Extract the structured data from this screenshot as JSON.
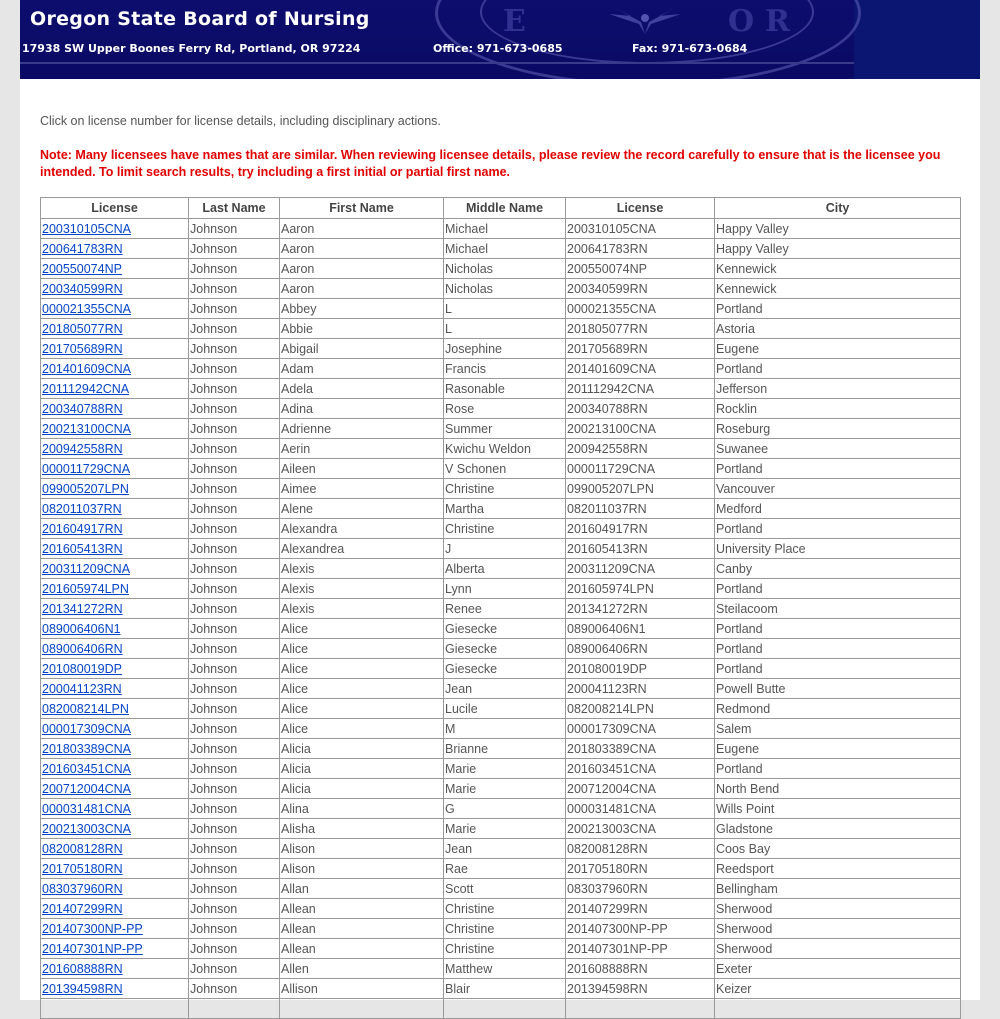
{
  "header": {
    "title": "Oregon State Board of Nursing",
    "address": "17938 SW Upper Boones Ferry Rd, Portland, OR 97224",
    "office": "Office: 971-673-0685",
    "fax": "Fax: 971-673-0684"
  },
  "intro": "Click on license number for license details, including disciplinary actions.",
  "note": "Note: Many licensees have names that are similar. When reviewing licensee details, please review the record carefully to ensure that is the licensee you intended. To limit search results, try including a first initial or partial first name.",
  "table": {
    "columns": [
      "License",
      "Last Name",
      "First Name",
      "Middle Name",
      "License",
      "City"
    ],
    "rows": [
      [
        "200310105CNA",
        "Johnson",
        "Aaron",
        "Michael",
        "200310105CNA",
        "Happy Valley"
      ],
      [
        "200641783RN",
        "Johnson",
        "Aaron",
        "Michael",
        "200641783RN",
        "Happy Valley"
      ],
      [
        "200550074NP",
        "Johnson",
        "Aaron",
        "Nicholas",
        "200550074NP",
        "Kennewick"
      ],
      [
        "200340599RN",
        "Johnson",
        "Aaron",
        "Nicholas",
        "200340599RN",
        "Kennewick"
      ],
      [
        "000021355CNA",
        "Johnson",
        "Abbey",
        "L",
        "000021355CNA",
        "Portland"
      ],
      [
        "201805077RN",
        "Johnson",
        "Abbie",
        "L",
        "201805077RN",
        "Astoria"
      ],
      [
        "201705689RN",
        "Johnson",
        "Abigail",
        "Josephine",
        "201705689RN",
        "Eugene"
      ],
      [
        "201401609CNA",
        "Johnson",
        "Adam",
        "Francis",
        "201401609CNA",
        "Portland"
      ],
      [
        "201112942CNA",
        "Johnson",
        "Adela",
        "Rasonable",
        "201112942CNA",
        "Jefferson"
      ],
      [
        "200340788RN",
        "Johnson",
        "Adina",
        "Rose",
        "200340788RN",
        "Rocklin"
      ],
      [
        "200213100CNA",
        "Johnson",
        "Adrienne",
        "Summer",
        "200213100CNA",
        "Roseburg"
      ],
      [
        "200942558RN",
        "Johnson",
        "Aerin",
        "Kwichu Weldon",
        "200942558RN",
        "Suwanee"
      ],
      [
        "000011729CNA",
        "Johnson",
        "Aileen",
        "V Schonen",
        "000011729CNA",
        "Portland"
      ],
      [
        "099005207LPN",
        "Johnson",
        "Aimee",
        "Christine",
        "099005207LPN",
        "Vancouver"
      ],
      [
        "082011037RN",
        "Johnson",
        "Alene",
        "Martha",
        "082011037RN",
        "Medford"
      ],
      [
        "201604917RN",
        "Johnson",
        "Alexandra",
        "Christine",
        "201604917RN",
        "Portland"
      ],
      [
        "201605413RN",
        "Johnson",
        "Alexandrea",
        "J",
        "201605413RN",
        "University Place"
      ],
      [
        "200311209CNA",
        "Johnson",
        "Alexis",
        "Alberta",
        "200311209CNA",
        "Canby"
      ],
      [
        "201605974LPN",
        "Johnson",
        "Alexis",
        "Lynn",
        "201605974LPN",
        "Portland"
      ],
      [
        "201341272RN",
        "Johnson",
        "Alexis",
        "Renee",
        "201341272RN",
        "Steilacoom"
      ],
      [
        "089006406N1",
        "Johnson",
        "Alice",
        "Giesecke",
        "089006406N1",
        "Portland"
      ],
      [
        "089006406RN",
        "Johnson",
        "Alice",
        "Giesecke",
        "089006406RN",
        "Portland"
      ],
      [
        "201080019DP",
        "Johnson",
        "Alice",
        "Giesecke",
        "201080019DP",
        "Portland"
      ],
      [
        "200041123RN",
        "Johnson",
        "Alice",
        "Jean",
        "200041123RN",
        "Powell Butte"
      ],
      [
        "082008214LPN",
        "Johnson",
        "Alice",
        "Lucile",
        "082008214LPN",
        "Redmond"
      ],
      [
        "000017309CNA",
        "Johnson",
        "Alice",
        "M",
        "000017309CNA",
        "Salem"
      ],
      [
        "201803389CNA",
        "Johnson",
        "Alicia",
        "Brianne",
        "201803389CNA",
        "Eugene"
      ],
      [
        "201603451CNA",
        "Johnson",
        "Alicia",
        "Marie",
        "201603451CNA",
        "Portland"
      ],
      [
        "200712004CNA",
        "Johnson",
        "Alicia",
        "Marie",
        "200712004CNA",
        "North Bend"
      ],
      [
        "000031481CNA",
        "Johnson",
        "Alina",
        "G",
        "000031481CNA",
        "Wills Point"
      ],
      [
        "200213003CNA",
        "Johnson",
        "Alisha",
        "Marie",
        "200213003CNA",
        "Gladstone"
      ],
      [
        "082008128RN",
        "Johnson",
        "Alison",
        "Jean",
        "082008128RN",
        "Coos Bay"
      ],
      [
        "201705180RN",
        "Johnson",
        "Alison",
        "Rae",
        "201705180RN",
        "Reedsport"
      ],
      [
        "083037960RN",
        "Johnson",
        "Allan",
        "Scott",
        "083037960RN",
        "Bellingham"
      ],
      [
        "201407299RN",
        "Johnson",
        "Allean",
        "Christine",
        "201407299RN",
        "Sherwood"
      ],
      [
        "201407300NP-PP",
        "Johnson",
        "Allean",
        "Christine",
        "201407300NP-PP",
        "Sherwood"
      ],
      [
        "201407301NP-PP",
        "Johnson",
        "Allean",
        "Christine",
        "201407301NP-PP",
        "Sherwood"
      ],
      [
        "201608888RN",
        "Johnson",
        "Allen",
        "Matthew",
        "201608888RN",
        "Exeter"
      ],
      [
        "201394598RN",
        "Johnson",
        "Allison",
        "Blair",
        "201394598RN",
        "Keizer"
      ],
      [
        "",
        "",
        "",
        "",
        "",
        ""
      ]
    ]
  },
  "colors": {
    "header_bg": "#06065a",
    "note_red": "#e00000",
    "link_blue": "#0645c8"
  }
}
